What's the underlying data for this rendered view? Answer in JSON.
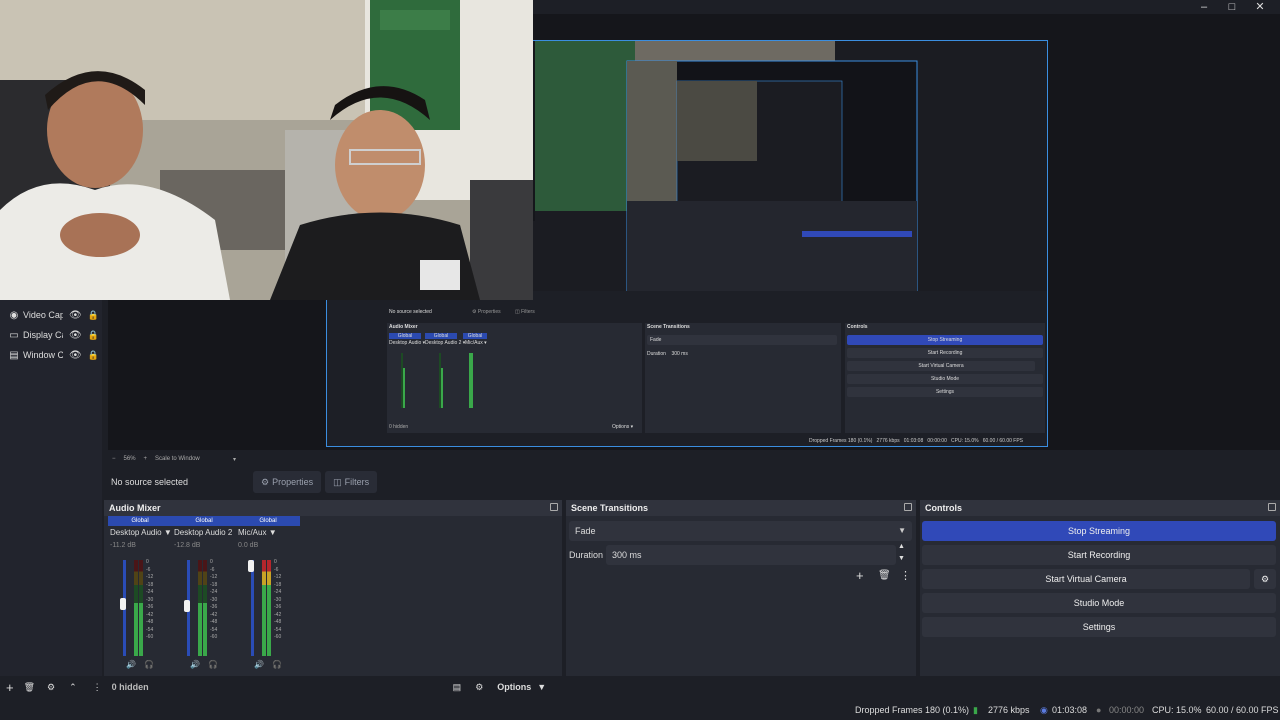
{
  "window": {
    "minimize": "–",
    "maximize": "□",
    "close": "✕"
  },
  "sources": {
    "items": [
      {
        "label": "Video Cap",
        "icon": "camera-icon"
      },
      {
        "label": "Display Ca",
        "icon": "monitor-icon"
      },
      {
        "label": "Window C",
        "icon": "window-icon"
      }
    ]
  },
  "zoom": {
    "minus": "−",
    "value": "56%",
    "plus": "+",
    "scale": "Scale to Window"
  },
  "context": {
    "no_source": "No source selected",
    "properties": "Properties",
    "filters": "Filters"
  },
  "mixer": {
    "title": "Audio Mixer",
    "channels": [
      {
        "global": "Global",
        "name": "Desktop Audio",
        "db": "-11.2 dB",
        "level": 0.55
      },
      {
        "global": "Global",
        "name": "Desktop Audio 2",
        "db": "-12.8 dB",
        "level": 0.52
      },
      {
        "global": "Global",
        "name": "Mic/Aux",
        "db": "0.0 dB",
        "level": 1.0
      }
    ],
    "scale": [
      "0",
      "-6",
      "-12",
      "-18",
      "-24",
      "-30",
      "-36",
      "-42",
      "-48",
      "-54",
      "-60"
    ]
  },
  "transitions": {
    "title": "Scene Transitions",
    "selected": "Fade",
    "duration_label": "Duration",
    "duration_value": "300 ms"
  },
  "controls": {
    "title": "Controls",
    "stop_streaming": "Stop Streaming",
    "start_recording": "Start Recording",
    "start_virtual_camera": "Start Virtual Camera",
    "studio_mode": "Studio Mode",
    "settings": "Settings"
  },
  "bottom_toolbar": {
    "hidden": "0 hidden",
    "options": "Options"
  },
  "status": {
    "dropped": "Dropped Frames 180 (0.1%)",
    "kbps": "2776 kbps",
    "stream_time": "01:03:08",
    "rec_time": "00:00:00",
    "cpu": "CPU: 15.0%",
    "fps": "60.00 / 60.00 FPS"
  },
  "colors": {
    "accent": "#3049b8",
    "background": "#1d1f26",
    "dock": "#272a33",
    "meter_green": "#3aa84a",
    "meter_yellow": "#c8a326",
    "meter_red": "#b4262c"
  }
}
